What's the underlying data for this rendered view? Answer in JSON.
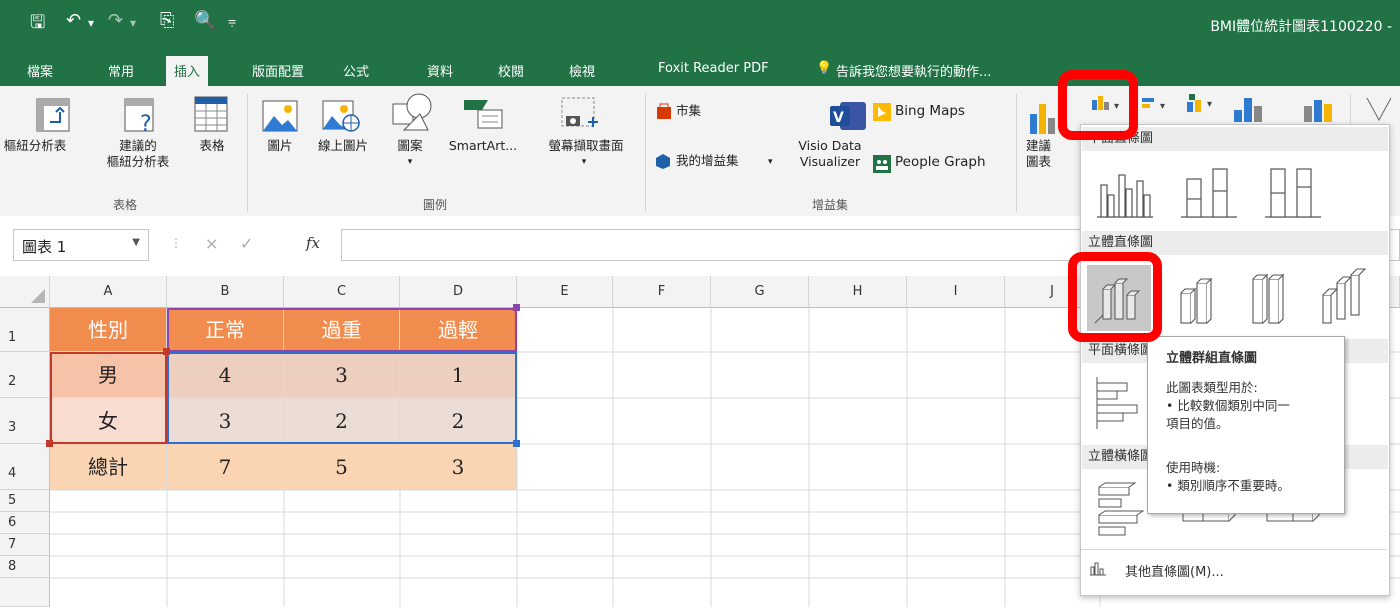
{
  "window": {
    "title": "BMI體位統計圖表1100220 -"
  },
  "tabs": [
    "檔案",
    "常用",
    "插入",
    "版面配置",
    "公式",
    "資料",
    "校閱",
    "檢視",
    "Foxit Reader PDF"
  ],
  "tell_me": "告訴我您想要執行的動作...",
  "ribbon": {
    "pivot_table": "樞紐分析表",
    "recommended_pivot": "建議的\n樞紐分析表",
    "table": "表格",
    "group_tables": "表格",
    "picture": "圖片",
    "online_picture": "線上圖片",
    "shapes": "圖案",
    "smartart": "SmartArt...",
    "screenshot": "螢幕擷取畫面",
    "group_illustrations": "圖例",
    "store": "市集",
    "my_addins": "我的增益集",
    "visio": "Visio Data\nVisualizer",
    "bing_maps": "Bing Maps",
    "people_graph": "People Graph",
    "group_addins": "增益集",
    "recommended_charts": "建議\n圖表"
  },
  "formula_bar": {
    "name_box": "圖表 1",
    "fx": "fx",
    "cancel": "×",
    "enter": "✓",
    "formula": ""
  },
  "columns": [
    "A",
    "B",
    "C",
    "D",
    "E",
    "F",
    "G",
    "H",
    "I",
    "J"
  ],
  "rows": [
    "1",
    "2",
    "3",
    "4",
    "5",
    "6",
    "7",
    "8"
  ],
  "table": {
    "header": [
      "性別",
      "正常",
      "過重",
      "過輕"
    ],
    "rows": [
      [
        "男",
        "4",
        "3",
        "1"
      ],
      [
        "女",
        "3",
        "2",
        "2"
      ],
      [
        "總計",
        "7",
        "5",
        "3"
      ]
    ]
  },
  "dropdown": {
    "section_2d_column": "平面直條圖",
    "section_3d_column": "立體直條圖",
    "section_2d_bar": "平面橫條圖",
    "section_3d_bar": "立體橫條圖",
    "more": "其他直條圖(M)..."
  },
  "tooltip": {
    "title": "立體群組直條圖",
    "line1": "此圖表類型用於:",
    "line2": "• 比較數個類別中同一",
    "line3": "項目的值。",
    "line4": "使用時機:",
    "line5": "• 類別順序不重要時。"
  },
  "colors": {
    "excel_green": "#217346",
    "header_orange": "#f28c4e",
    "row_pink": "#f6c8b0",
    "total_peach": "#fbd4b4",
    "highlight_red": "#ff0000"
  }
}
